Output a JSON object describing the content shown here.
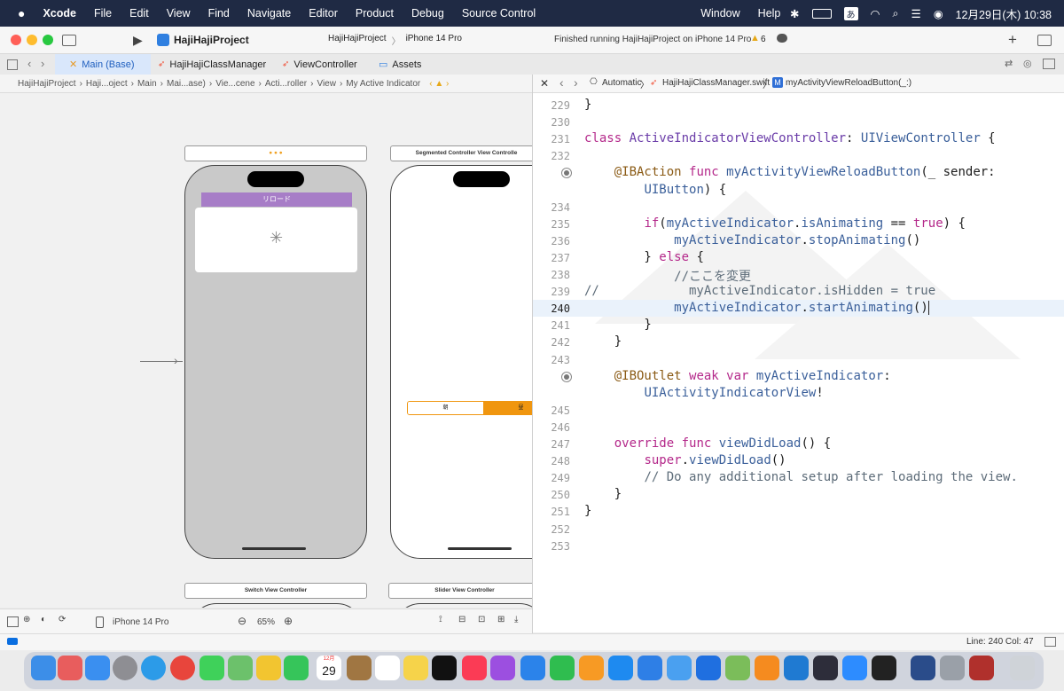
{
  "menubar": {
    "app": "Xcode",
    "items": [
      "File",
      "Edit",
      "View",
      "Find",
      "Navigate",
      "Editor",
      "Product",
      "Debug",
      "Source Control",
      "Window",
      "Help"
    ],
    "input_method": "あ",
    "datetime": "12月29日(木) 10:38"
  },
  "toolbar": {
    "project": "HajiHajiProject",
    "scheme": "HajiHajiProject",
    "device": "iPhone 14 Pro",
    "status": "Finished running HajiHajiProject on iPhone 14 Pro",
    "warnings": "6"
  },
  "tabs": [
    {
      "label": "Main (Base)",
      "icon": "xib-icon"
    },
    {
      "label": "HajiHajiClassManager",
      "icon": "swift-icon"
    },
    {
      "label": "ViewController",
      "icon": "swift-icon"
    },
    {
      "label": "Assets",
      "icon": "assets-icon"
    }
  ],
  "left_jumpbar": [
    "HajiHajiProject",
    "Haji...oject",
    "Main",
    "Mai...ase)",
    "Vie...cene",
    "Acti...roller",
    "View",
    "My Active Indicator"
  ],
  "canvas": {
    "scene_title_2": "Segmented Controller View Controlle",
    "reload_button": "リロード",
    "segment_1": "朝",
    "segment_2": "昼",
    "scene_bottom_1": "Switch View Controller",
    "scene_bottom_2": "Slider View Controller"
  },
  "left_bottom": {
    "device": "iPhone 14 Pro",
    "zoom": "65%"
  },
  "right_jumpbar": {
    "mode": "Automatic",
    "file": "HajiHajiClassManager.swift",
    "method": "myActivityViewReloadButton(_:)"
  },
  "code_lines": [
    {
      "n": "229",
      "html": "}"
    },
    {
      "n": "230",
      "html": ""
    },
    {
      "n": "231",
      "html": "<span class='kw'>class</span> <span class='ty'>ActiveIndicatorViewController</span>: <span class='fn'>UIViewController</span> {"
    },
    {
      "n": "232",
      "html": ""
    },
    {
      "n": "",
      "html": "    <span class='attr'>@IBAction</span> <span class='kw'>func</span> <span class='fn'>myActivityViewReloadButton</span>(_ sender:",
      "bp": true
    },
    {
      "n": "",
      "html": "        <span class='fn'>UIButton</span>) {"
    },
    {
      "n": "234",
      "html": ""
    },
    {
      "n": "235",
      "html": "        <span class='kw'>if</span>(<span class='fn'>myActiveIndicator</span>.<span class='fn'>isAnimating</span> == <span class='kw'>true</span>) {"
    },
    {
      "n": "236",
      "html": "            <span class='fn'>myActiveIndicator</span>.<span class='fn'>stopAnimating</span>()"
    },
    {
      "n": "237",
      "html": "        } <span class='kw'>else</span> {"
    },
    {
      "n": "238",
      "html": "            <span class='cm'>//ここを変更</span>"
    },
    {
      "n": "239",
      "html": "<span class='cm'>//            myActiveIndicator.isHidden = true</span>"
    },
    {
      "n": "240",
      "html": "            <span class='fn'>myActiveIndicator</span>.<span class='fn'>startAnimating</span>()",
      "current": true
    },
    {
      "n": "241",
      "html": "        }"
    },
    {
      "n": "242",
      "html": "    }"
    },
    {
      "n": "243",
      "html": ""
    },
    {
      "n": "",
      "html": "    <span class='attr'>@IBOutlet</span> <span class='kw'>weak</span> <span class='kw'>var</span> <span class='fn'>myActiveIndicator</span>:",
      "bp": true
    },
    {
      "n": "",
      "html": "        <span class='fn'>UIActivityIndicatorView</span>!"
    },
    {
      "n": "245",
      "html": ""
    },
    {
      "n": "246",
      "html": ""
    },
    {
      "n": "247",
      "html": "    <span class='kw'>override</span> <span class='kw'>func</span> <span class='fn'>viewDidLoad</span>() {"
    },
    {
      "n": "248",
      "html": "        <span class='kw'>super</span>.<span class='fn'>viewDidLoad</span>()"
    },
    {
      "n": "249",
      "html": "        <span class='cm'>// Do any additional setup after loading the view.</span>"
    },
    {
      "n": "250",
      "html": "    }"
    },
    {
      "n": "251",
      "html": "}"
    },
    {
      "n": "252",
      "html": ""
    },
    {
      "n": "253",
      "html": ""
    }
  ],
  "statusbar": {
    "position": "Line: 240  Col: 47"
  },
  "dock": {
    "calendar_month": "12月",
    "calendar_day": "29"
  },
  "colors": {
    "accent": "#0a6ee0",
    "current_line": "#eaf2fb",
    "keyword": "#b4288a",
    "comment": "#5d6c79",
    "reload_button": "#a77dc7",
    "segment_selected": "#f0960f"
  }
}
